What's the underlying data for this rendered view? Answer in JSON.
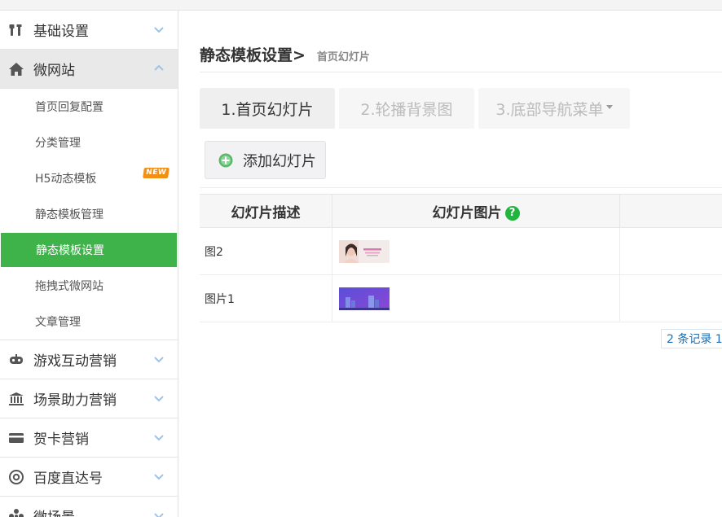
{
  "sidebar": {
    "groups_top": [
      {
        "label": "基础设置",
        "icon": "tools-icon"
      },
      {
        "label": "微网站",
        "icon": "home-icon"
      }
    ],
    "sub_items": [
      {
        "label": "首页回复配置"
      },
      {
        "label": "分类管理"
      },
      {
        "label": "H5动态模板",
        "badge": "NEW"
      },
      {
        "label": "静态模板管理"
      },
      {
        "label": "静态模板设置"
      },
      {
        "label": "拖拽式微网站"
      },
      {
        "label": "文章管理"
      }
    ],
    "groups_bottom": [
      {
        "label": "游戏互动营销",
        "icon": "gamepad-icon"
      },
      {
        "label": "场景助力营销",
        "icon": "bank-icon"
      },
      {
        "label": "贺卡营销",
        "icon": "card-icon"
      },
      {
        "label": "百度直达号",
        "icon": "at-icon"
      },
      {
        "label": "微场景",
        "icon": "flower-icon"
      }
    ],
    "active_color": "#3db34a"
  },
  "page": {
    "title": "静态模板设置>",
    "subtitle": "首页幻灯片"
  },
  "tabs": [
    {
      "label": "1.首页幻灯片",
      "active": true
    },
    {
      "label": "2.轮播背景图",
      "active": false
    },
    {
      "label": "3.底部导航菜单",
      "active": false,
      "dropdown": true
    }
  ],
  "toolbar": {
    "add_label": "添加幻灯片"
  },
  "table": {
    "columns": [
      "幻灯片描述",
      "幻灯片图片",
      ""
    ],
    "help_glyph": "?",
    "rows": [
      {
        "description": "图2",
        "image": "woman-portrait-banner"
      },
      {
        "description": "图片1",
        "image": "purple-city-banner"
      }
    ]
  },
  "pager": {
    "text": "2 条记录 1"
  }
}
